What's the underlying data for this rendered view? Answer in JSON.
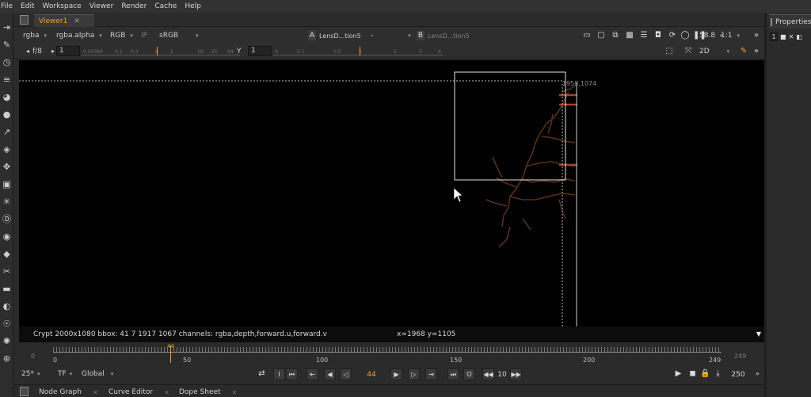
{
  "menu": [
    "File",
    "Edit",
    "Workspace",
    "Viewer",
    "Render",
    "Cache",
    "Help"
  ],
  "viewer": {
    "tab_title": "Viewer1",
    "tab_close": "✕",
    "layer": "rgba",
    "channel": "rgba.alpha",
    "display_channels": "RGB",
    "ip_label": "IP",
    "colorspace": "sRGB",
    "input_a": {
      "letter": "A",
      "name": "LensD...tion5"
    },
    "ab_separator": "-",
    "input_b": {
      "letter": "B",
      "name": "LensD...tion5"
    },
    "zoom": "58.8",
    "proxy": "1:1",
    "fstop": "f/8",
    "gain_value": "1",
    "gamma_label": "Y",
    "gamma_value": "1",
    "view_mode": "2D",
    "gain_ticks": [
      "0.00390",
      "0.1",
      "0.3",
      "1",
      "2",
      "16",
      "25",
      "64"
    ],
    "gamma_ticks": [
      "0",
      "0.1",
      "0.5",
      "1",
      "2",
      "3",
      "4"
    ]
  },
  "canvas": {
    "format_label": "1958,1074"
  },
  "status": {
    "info": "Crypt 2000x1080  bbox: 41 7 1917 1067 channels: rgba,depth,forward.u,forward.v",
    "coords": "x=1968 y=1105"
  },
  "timeline": {
    "in_point": "0",
    "out_point": "249",
    "current_frame": "44",
    "labels": [
      "0",
      "50",
      "100",
      "150",
      "200",
      "249"
    ],
    "fps": "25*",
    "tf": "TF",
    "range_mode": "Global",
    "increment": "10",
    "end_frame": "250"
  },
  "bottom_tabs": [
    "Node Graph",
    "Curve Editor",
    "Dope Sheet"
  ],
  "properties": {
    "tab_title": "Properties",
    "count": "1"
  },
  "colors": {
    "accent": "#f0a030",
    "canvas": "#000000",
    "crack": "#5a2e1c"
  }
}
